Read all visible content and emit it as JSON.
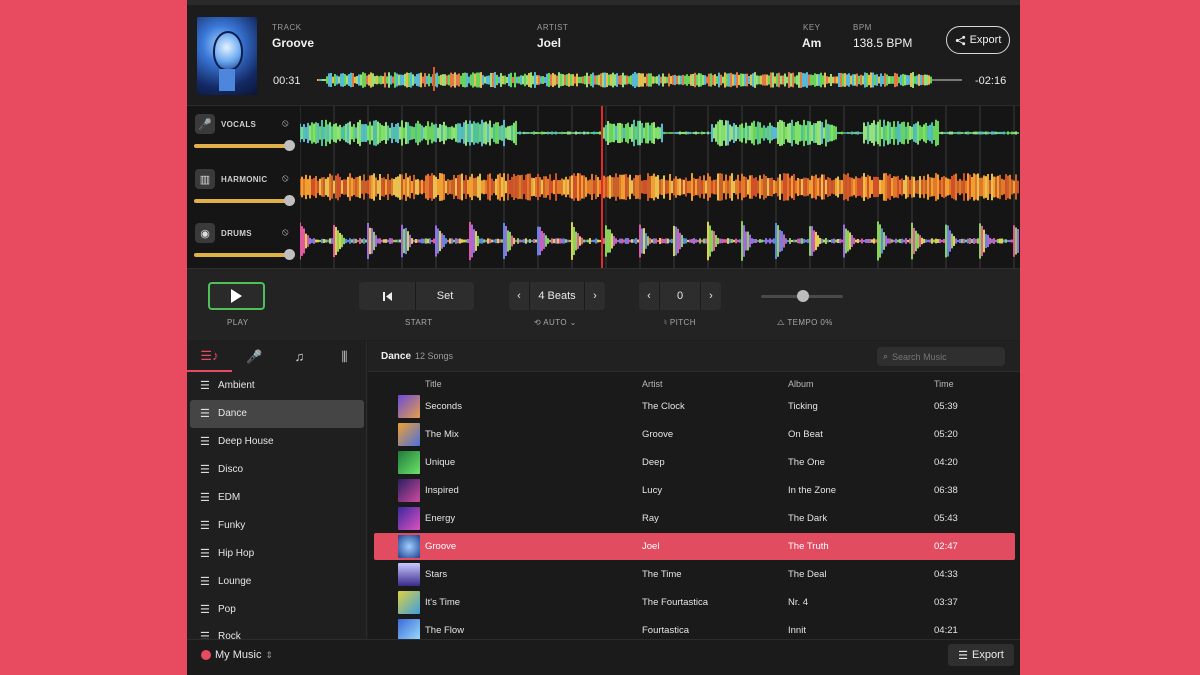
{
  "header": {
    "track_label": "TRACK",
    "track_value": "Groove",
    "artist_label": "ARTIST",
    "artist_value": "Joel",
    "key_label": "KEY",
    "key_value": "Am",
    "bpm_label": "BPM",
    "bpm_value": "138.5 BPM",
    "export_label": "Export",
    "time_elapsed": "00:31",
    "time_remaining": "-02:16",
    "artwork_icon": "robot-head-artwork"
  },
  "stems": [
    {
      "name": "VOCALS",
      "icon": "microphone-icon",
      "volume": 0.9
    },
    {
      "name": "HARMONIC",
      "icon": "piano-icon",
      "volume": 0.9
    },
    {
      "name": "DRUMS",
      "icon": "drum-icon",
      "volume": 0.9
    }
  ],
  "transport": {
    "play_label": "PLAY",
    "start_label": "START",
    "set_label": "Set",
    "loop_value": "4 Beats",
    "auto_label": "AUTO",
    "pitch_value": "0",
    "pitch_label": "PITCH",
    "tempo_label": "TEMPO 0%",
    "tempo_value": 0.5
  },
  "sidebar": {
    "tabs": [
      "playlists-icon",
      "microphone-icon",
      "music-note-icon",
      "instruments-icon"
    ],
    "items": [
      {
        "label": "Ambient"
      },
      {
        "label": "Dance"
      },
      {
        "label": "Deep House"
      },
      {
        "label": "Disco"
      },
      {
        "label": "EDM"
      },
      {
        "label": "Funky"
      },
      {
        "label": "Hip Hop"
      },
      {
        "label": "Lounge"
      },
      {
        "label": "Pop"
      },
      {
        "label": "Rock"
      }
    ]
  },
  "library": {
    "playlist_name": "Dance",
    "song_count": "12 Songs",
    "search_placeholder": "Search Music",
    "columns": {
      "title": "Title",
      "artist": "Artist",
      "album": "Album",
      "time": "Time"
    },
    "songs": [
      {
        "title": "Seconds",
        "artist": "The Clock",
        "album": "Ticking",
        "time": "05:39"
      },
      {
        "title": "The Mix",
        "artist": "Groove",
        "album": "On Beat",
        "time": "05:20"
      },
      {
        "title": "Unique",
        "artist": "Deep",
        "album": "The One",
        "time": "04:20"
      },
      {
        "title": "Inspired",
        "artist": "Lucy",
        "album": "In the Zone",
        "time": "06:38"
      },
      {
        "title": "Energy",
        "artist": "Ray",
        "album": "The Dark",
        "time": "05:43"
      },
      {
        "title": "Groove",
        "artist": "Joel",
        "album": "The Truth",
        "time": "02:47"
      },
      {
        "title": "Stars",
        "artist": "The Time",
        "album": "The Deal",
        "time": "04:33"
      },
      {
        "title": "It's Time",
        "artist": "The Fourtastica",
        "album": "Nr. 4",
        "time": "03:37"
      },
      {
        "title": "The Flow",
        "artist": "Fourtastica",
        "album": "Innit",
        "time": "04:21"
      }
    ]
  },
  "footer": {
    "source_label": "My Music",
    "export_label": "Export"
  },
  "colors": {
    "accent": "#e84a5f",
    "play_border": "#4ec05a",
    "slider": "#e0b04a",
    "playhead": "#e32a2a"
  }
}
